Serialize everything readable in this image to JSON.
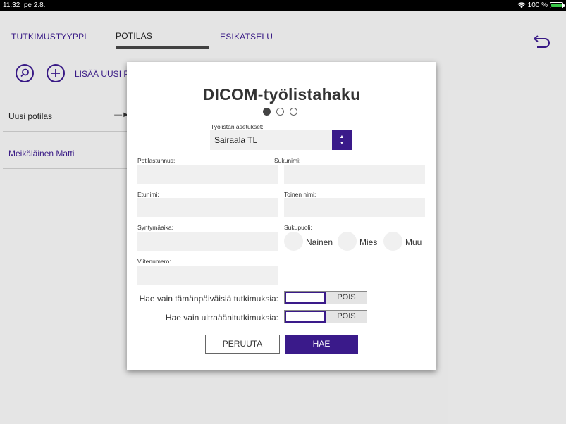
{
  "status_bar": {
    "time": "11.32",
    "date": "pe 2.8.",
    "battery_text": "100 %",
    "wifi_icon": "wifi-icon",
    "battery_icon": "battery-charging-icon"
  },
  "tabs": [
    {
      "label": "TUTKIMUSTYYPPI",
      "active": false
    },
    {
      "label": "POTILAS",
      "active": true
    },
    {
      "label": "ESIKATSELU",
      "active": false
    }
  ],
  "toolbar": {
    "add_label": "LISÄÄ UUSI PO"
  },
  "patients": {
    "new_patient_label": "Uusi potilas",
    "items": [
      {
        "name": "Meikäläinen Matti"
      }
    ]
  },
  "modal": {
    "title": "DICOM-työlistahaku",
    "page_indicator": {
      "total": 3,
      "current": 1
    },
    "worklist_settings_label": "Työlistan asetukset:",
    "worklist_settings_value": "Sairaala TL",
    "fields": {
      "patient_id_label": "Potilastunnus:",
      "patient_id_value": "",
      "surname_label": "Sukunimi:",
      "surname_value": "",
      "first_name_label": "Etunimi:",
      "first_name_value": "",
      "second_name_label": "Toinen nimi:",
      "second_name_value": "",
      "birthdate_label": "Syntymäaika:",
      "birthdate_value": "",
      "sex_label": "Sukupuoli:",
      "sex_options": [
        "Nainen",
        "Mies",
        "Muu"
      ],
      "reference_label": "Viitenumero:",
      "reference_value": ""
    },
    "toggles": {
      "today_only_label": "Hae vain tämänpäiväisiä tutkimuksia:",
      "today_only_state": "POIS",
      "ultrasound_only_label": "Hae vain ultraäänitutkimuksia:",
      "ultrasound_only_state": "POIS"
    },
    "cancel_label": "PERUUTA",
    "search_label": "HAE"
  },
  "colors": {
    "accent": "#3a1a8a",
    "field_bg": "#f0f0f0",
    "background": "#ececec"
  }
}
